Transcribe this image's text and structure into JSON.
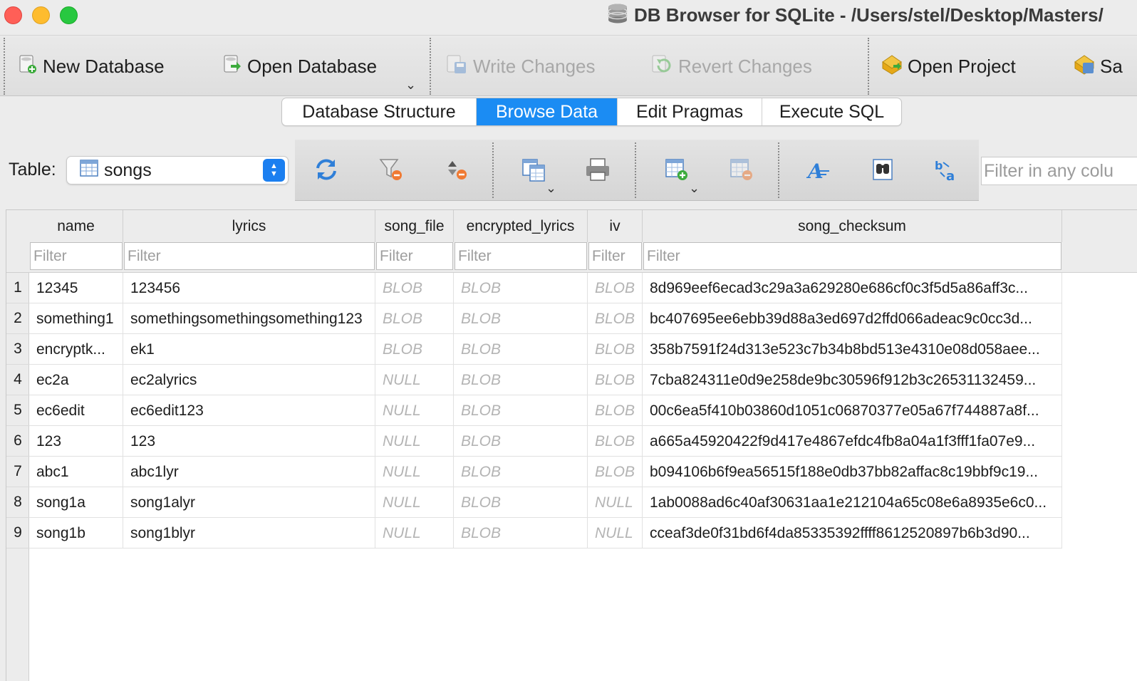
{
  "window": {
    "title": "DB Browser for SQLite - /Users/stel/Desktop/Masters/"
  },
  "toolbar": {
    "new_database": "New Database",
    "open_database": "Open Database",
    "write_changes": "Write Changes",
    "revert_changes": "Revert Changes",
    "open_project": "Open Project",
    "save_project": "Sa"
  },
  "tabs": [
    {
      "label": "Database Structure",
      "active": false
    },
    {
      "label": "Browse Data",
      "active": true
    },
    {
      "label": "Edit Pragmas",
      "active": false
    },
    {
      "label": "Execute SQL",
      "active": false
    }
  ],
  "browse": {
    "table_label": "Table:",
    "table_value": "songs",
    "filter_any_placeholder": "Filter in any colu"
  },
  "grid": {
    "columns": [
      "name",
      "lyrics",
      "song_file",
      "encrypted_lyrics",
      "iv",
      "song_checksum"
    ],
    "filter_placeholder": "Filter",
    "rows": [
      {
        "num": "1",
        "cells": [
          "12345",
          "123456",
          "BLOB",
          "BLOB",
          "BLOB",
          "8d969eef6ecad3c29a3a629280e686cf0c3f5d5a86aff3c..."
        ]
      },
      {
        "num": "2",
        "cells": [
          "something1",
          "somethingsomethingsomething123",
          "BLOB",
          "BLOB",
          "BLOB",
          "bc407695ee6ebb39d88a3ed697d2ffd066adeac9c0cc3d..."
        ]
      },
      {
        "num": "3",
        "cells": [
          "encryptk...",
          "ek1",
          "BLOB",
          "BLOB",
          "BLOB",
          "358b7591f24d313e523c7b34b8bd513e4310e08d058aee..."
        ]
      },
      {
        "num": "4",
        "cells": [
          "ec2a",
          "ec2alyrics",
          "NULL",
          "BLOB",
          "BLOB",
          "7cba824311e0d9e258de9bc30596f912b3c26531132459..."
        ]
      },
      {
        "num": "5",
        "cells": [
          "ec6edit",
          "ec6edit123",
          "NULL",
          "BLOB",
          "BLOB",
          "00c6ea5f410b03860d1051c06870377e05a67f744887a8f..."
        ]
      },
      {
        "num": "6",
        "cells": [
          "123",
          "123",
          "NULL",
          "BLOB",
          "BLOB",
          "a665a45920422f9d417e4867efdc4fb8a04a1f3fff1fa07e9..."
        ]
      },
      {
        "num": "7",
        "cells": [
          "abc1",
          "abc1lyr",
          "NULL",
          "BLOB",
          "BLOB",
          "b094106b6f9ea56515f188e0db37bb82affac8c19bbf9c19..."
        ]
      },
      {
        "num": "8",
        "cells": [
          "song1a",
          "song1alyr",
          "NULL",
          "BLOB",
          "NULL",
          "1ab0088ad6c40af30631aa1e212104a65c08e6a8935e6c0..."
        ]
      },
      {
        "num": "9",
        "cells": [
          "song1b",
          "song1blyr",
          "NULL",
          "BLOB",
          "NULL",
          "cceaf3de0f31bd6f4da85335392ffff8612520897b6b3d90..."
        ]
      }
    ]
  },
  "colors": {
    "accent": "#1b8cf3",
    "placeholder_text": "#b4b4b4"
  },
  "icons": [
    "database-icon",
    "new-database-icon",
    "open-database-icon",
    "write-changes-icon",
    "revert-changes-icon",
    "open-project-icon",
    "save-project-icon",
    "table-icon",
    "refresh-icon",
    "clear-filters-icon",
    "sort-icon",
    "copy-icon",
    "print-icon",
    "insert-record-icon",
    "delete-record-icon",
    "font-icon",
    "find-icon",
    "find-replace-icon"
  ]
}
